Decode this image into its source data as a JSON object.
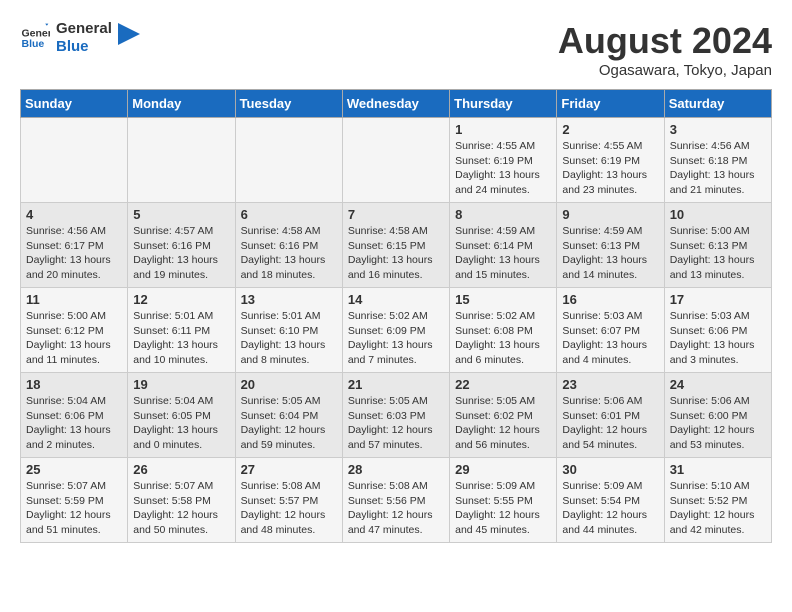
{
  "logo": {
    "line1": "General",
    "line2": "Blue"
  },
  "title": "August 2024",
  "location": "Ogasawara, Tokyo, Japan",
  "weekdays": [
    "Sunday",
    "Monday",
    "Tuesday",
    "Wednesday",
    "Thursday",
    "Friday",
    "Saturday"
  ],
  "weeks": [
    [
      {
        "day": "",
        "info": ""
      },
      {
        "day": "",
        "info": ""
      },
      {
        "day": "",
        "info": ""
      },
      {
        "day": "",
        "info": ""
      },
      {
        "day": "1",
        "info": "Sunrise: 4:55 AM\nSunset: 6:19 PM\nDaylight: 13 hours\nand 24 minutes."
      },
      {
        "day": "2",
        "info": "Sunrise: 4:55 AM\nSunset: 6:19 PM\nDaylight: 13 hours\nand 23 minutes."
      },
      {
        "day": "3",
        "info": "Sunrise: 4:56 AM\nSunset: 6:18 PM\nDaylight: 13 hours\nand 21 minutes."
      }
    ],
    [
      {
        "day": "4",
        "info": "Sunrise: 4:56 AM\nSunset: 6:17 PM\nDaylight: 13 hours\nand 20 minutes."
      },
      {
        "day": "5",
        "info": "Sunrise: 4:57 AM\nSunset: 6:16 PM\nDaylight: 13 hours\nand 19 minutes."
      },
      {
        "day": "6",
        "info": "Sunrise: 4:58 AM\nSunset: 6:16 PM\nDaylight: 13 hours\nand 18 minutes."
      },
      {
        "day": "7",
        "info": "Sunrise: 4:58 AM\nSunset: 6:15 PM\nDaylight: 13 hours\nand 16 minutes."
      },
      {
        "day": "8",
        "info": "Sunrise: 4:59 AM\nSunset: 6:14 PM\nDaylight: 13 hours\nand 15 minutes."
      },
      {
        "day": "9",
        "info": "Sunrise: 4:59 AM\nSunset: 6:13 PM\nDaylight: 13 hours\nand 14 minutes."
      },
      {
        "day": "10",
        "info": "Sunrise: 5:00 AM\nSunset: 6:13 PM\nDaylight: 13 hours\nand 13 minutes."
      }
    ],
    [
      {
        "day": "11",
        "info": "Sunrise: 5:00 AM\nSunset: 6:12 PM\nDaylight: 13 hours\nand 11 minutes."
      },
      {
        "day": "12",
        "info": "Sunrise: 5:01 AM\nSunset: 6:11 PM\nDaylight: 13 hours\nand 10 minutes."
      },
      {
        "day": "13",
        "info": "Sunrise: 5:01 AM\nSunset: 6:10 PM\nDaylight: 13 hours\nand 8 minutes."
      },
      {
        "day": "14",
        "info": "Sunrise: 5:02 AM\nSunset: 6:09 PM\nDaylight: 13 hours\nand 7 minutes."
      },
      {
        "day": "15",
        "info": "Sunrise: 5:02 AM\nSunset: 6:08 PM\nDaylight: 13 hours\nand 6 minutes."
      },
      {
        "day": "16",
        "info": "Sunrise: 5:03 AM\nSunset: 6:07 PM\nDaylight: 13 hours\nand 4 minutes."
      },
      {
        "day": "17",
        "info": "Sunrise: 5:03 AM\nSunset: 6:06 PM\nDaylight: 13 hours\nand 3 minutes."
      }
    ],
    [
      {
        "day": "18",
        "info": "Sunrise: 5:04 AM\nSunset: 6:06 PM\nDaylight: 13 hours\nand 2 minutes."
      },
      {
        "day": "19",
        "info": "Sunrise: 5:04 AM\nSunset: 6:05 PM\nDaylight: 13 hours\nand 0 minutes."
      },
      {
        "day": "20",
        "info": "Sunrise: 5:05 AM\nSunset: 6:04 PM\nDaylight: 12 hours\nand 59 minutes."
      },
      {
        "day": "21",
        "info": "Sunrise: 5:05 AM\nSunset: 6:03 PM\nDaylight: 12 hours\nand 57 minutes."
      },
      {
        "day": "22",
        "info": "Sunrise: 5:05 AM\nSunset: 6:02 PM\nDaylight: 12 hours\nand 56 minutes."
      },
      {
        "day": "23",
        "info": "Sunrise: 5:06 AM\nSunset: 6:01 PM\nDaylight: 12 hours\nand 54 minutes."
      },
      {
        "day": "24",
        "info": "Sunrise: 5:06 AM\nSunset: 6:00 PM\nDaylight: 12 hours\nand 53 minutes."
      }
    ],
    [
      {
        "day": "25",
        "info": "Sunrise: 5:07 AM\nSunset: 5:59 PM\nDaylight: 12 hours\nand 51 minutes."
      },
      {
        "day": "26",
        "info": "Sunrise: 5:07 AM\nSunset: 5:58 PM\nDaylight: 12 hours\nand 50 minutes."
      },
      {
        "day": "27",
        "info": "Sunrise: 5:08 AM\nSunset: 5:57 PM\nDaylight: 12 hours\nand 48 minutes."
      },
      {
        "day": "28",
        "info": "Sunrise: 5:08 AM\nSunset: 5:56 PM\nDaylight: 12 hours\nand 47 minutes."
      },
      {
        "day": "29",
        "info": "Sunrise: 5:09 AM\nSunset: 5:55 PM\nDaylight: 12 hours\nand 45 minutes."
      },
      {
        "day": "30",
        "info": "Sunrise: 5:09 AM\nSunset: 5:54 PM\nDaylight: 12 hours\nand 44 minutes."
      },
      {
        "day": "31",
        "info": "Sunrise: 5:10 AM\nSunset: 5:52 PM\nDaylight: 12 hours\nand 42 minutes."
      }
    ]
  ]
}
